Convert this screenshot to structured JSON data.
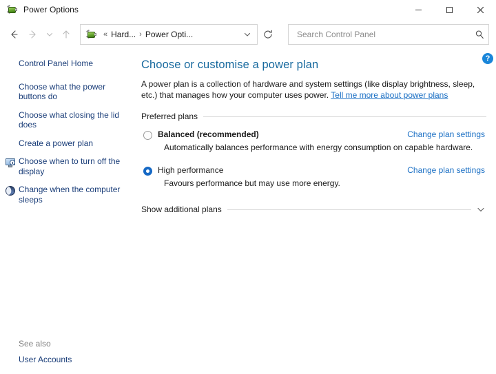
{
  "window": {
    "title": "Power Options",
    "icon": "power-plug-battery-icon",
    "controls": {
      "minimize": "Minimize",
      "maximize": "Maximize",
      "close": "Close"
    }
  },
  "toolbar": {
    "back": "Back",
    "forward": "Forward",
    "recent_locations": "Recent locations",
    "up": "Up",
    "refresh": "Refresh",
    "address": {
      "icon": "power-plug-battery-icon",
      "overflow": "«",
      "crumbs": [
        "Hard...",
        "Power Opti..."
      ],
      "separator": "›"
    },
    "search": {
      "placeholder": "Search Control Panel",
      "value": "",
      "icon": "search-icon"
    }
  },
  "sidebar": {
    "home": "Control Panel Home",
    "items": [
      {
        "label": "Choose what the power buttons do",
        "icon": ""
      },
      {
        "label": "Choose what closing the lid does",
        "icon": ""
      },
      {
        "label": "Create a power plan",
        "icon": ""
      },
      {
        "label": "Choose when to turn off the display",
        "icon": "monitor-clock-icon"
      },
      {
        "label": "Change when the computer sleeps",
        "icon": "moon-icon"
      }
    ],
    "see_also": {
      "label": "See also",
      "links": [
        "User Accounts"
      ]
    }
  },
  "content": {
    "help": "?",
    "title": "Choose or customise a power plan",
    "intro_text": "A power plan is a collection of hardware and system settings (like display brightness, sleep, etc.) that manages how your computer uses power.",
    "intro_link": "Tell me more about power plans",
    "section_label": "Preferred plans",
    "plans": [
      {
        "name": "Balanced (recommended)",
        "description": "Automatically balances performance with energy consumption on capable hardware.",
        "action": "Change plan settings",
        "selected": false,
        "bold": true
      },
      {
        "name": "High performance",
        "description": "Favours performance but may use more energy.",
        "action": "Change plan settings",
        "selected": true,
        "bold": false
      }
    ],
    "expander": {
      "label": "Show additional plans",
      "icon": "chevron-down-icon"
    }
  },
  "colors": {
    "accent_blue": "#1a6fc4",
    "title_blue": "#17699e",
    "sidebar_link": "#1b3e79",
    "radio_selected": "#1669c5",
    "help_badge": "#1a86d9"
  }
}
